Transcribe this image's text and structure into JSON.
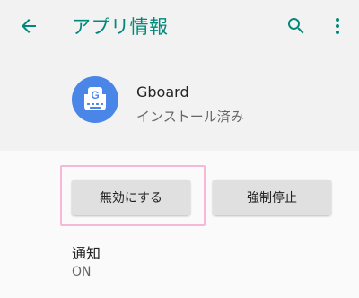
{
  "appbar": {
    "title": "アプリ情報",
    "back_icon": "arrow-back-icon",
    "search_icon": "search-icon",
    "more_icon": "more-vert-icon",
    "accent_color": "#00897b"
  },
  "app": {
    "name": "Gboard",
    "status": "インストール済み",
    "icon": "gboard-app-icon"
  },
  "actions": {
    "disable_label": "無効にする",
    "force_stop_label": "強制停止"
  },
  "notifications": {
    "title": "通知",
    "value": "ON"
  }
}
